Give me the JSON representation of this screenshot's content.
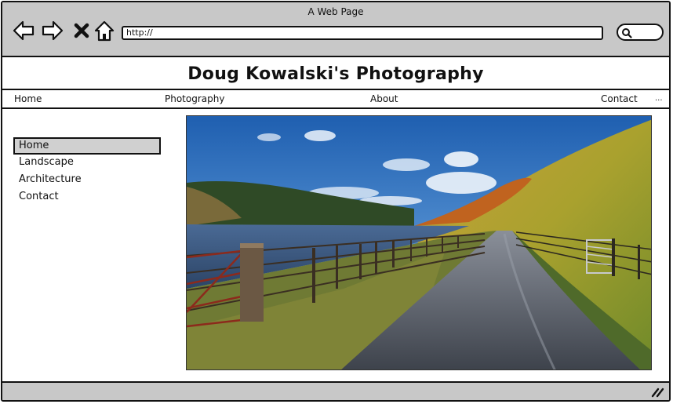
{
  "window": {
    "title": "A Web Page"
  },
  "toolbar": {
    "back_icon": "back-arrow-icon",
    "forward_icon": "forward-arrow-icon",
    "stop_icon": "close-icon",
    "home_icon": "home-icon",
    "url": "http://",
    "search_icon": "search-icon"
  },
  "site": {
    "title": "Doug Kowalski's Photography"
  },
  "topnav": {
    "items": [
      "Home",
      "Photography",
      "About",
      "Contact"
    ],
    "more": "..."
  },
  "sidenav": {
    "items": [
      "Home",
      "Landscape",
      "Architecture",
      "Contact"
    ],
    "active_index": 0
  },
  "photo": {
    "subject": "reservoir lakeside road with wooden fence and hillside"
  },
  "colors": {
    "chrome": "#c8c8c8",
    "active_item": "#d0d0d0",
    "border": "#111111"
  }
}
